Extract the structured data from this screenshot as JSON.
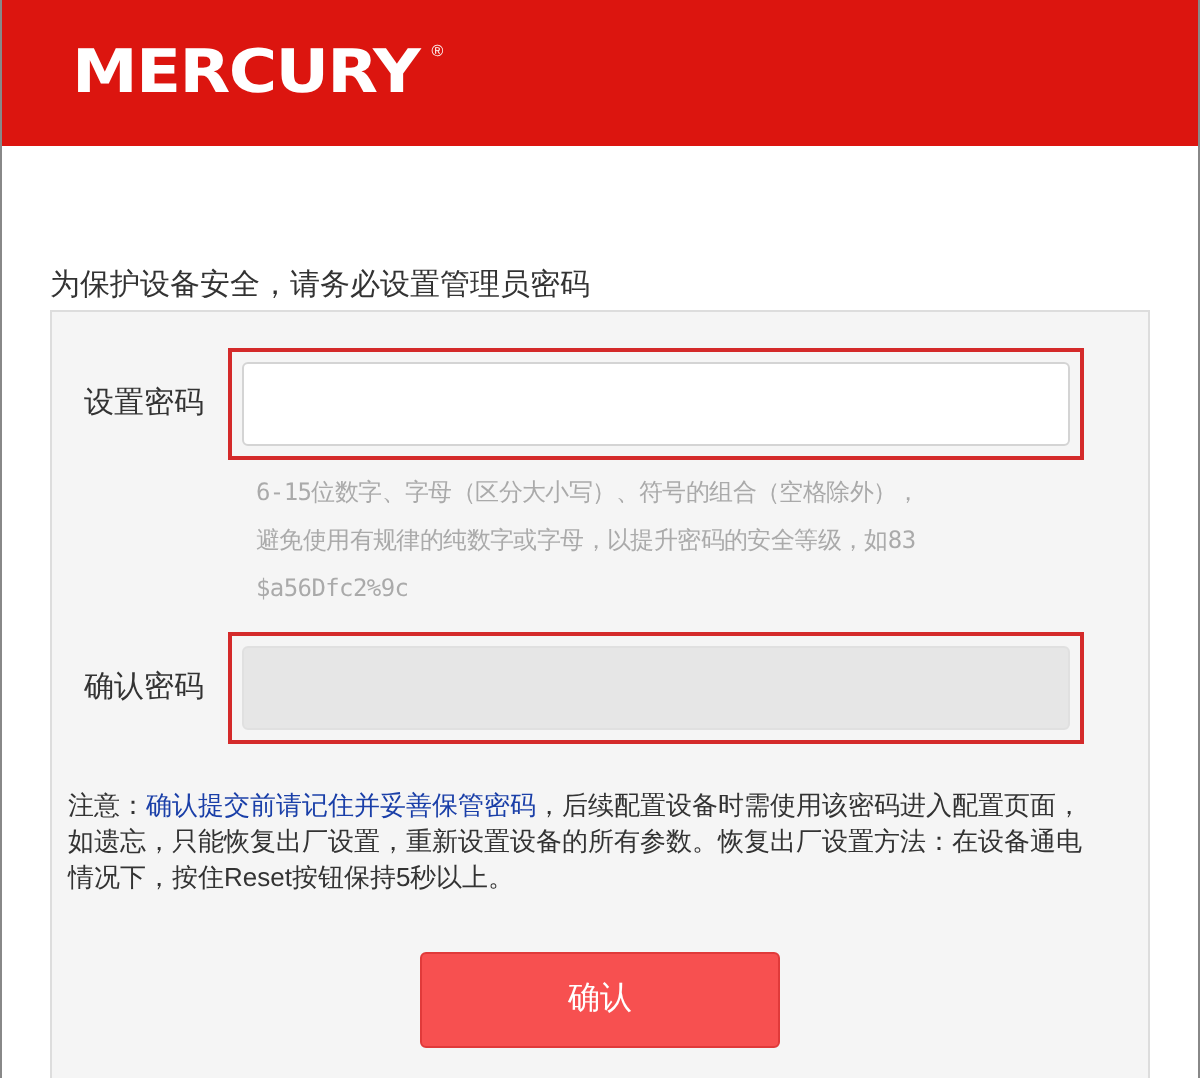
{
  "header": {
    "logo": "MERCURY",
    "logo_mark": "®"
  },
  "intro": "为保护设备安全，请务必设置管理员密码",
  "fields": [
    {
      "label": "设置密码",
      "disabled": false,
      "highlighted": true,
      "hint": [
        "6-15位数字、字母（区分大小写）、符号的组合（空格除外），",
        "避免使用有规律的纯数字或字母，以提升密码的安全等级，如83",
        "$a56Dfc2%9c"
      ]
    },
    {
      "label": "确认密码",
      "disabled": true,
      "highlighted": true
    }
  ],
  "notice": {
    "label": "注意：",
    "highlight": "确认提交前请记住并妥善保管密码",
    "text": "，后续配置设备时需使用该密码进入配置页面，如遗忘，只能恢复出厂设置，重新设置设备的所有参数。恢复出厂设置方法：在设备通电情况下，按住Reset按钮保持5秒以上。"
  },
  "button": "确认"
}
